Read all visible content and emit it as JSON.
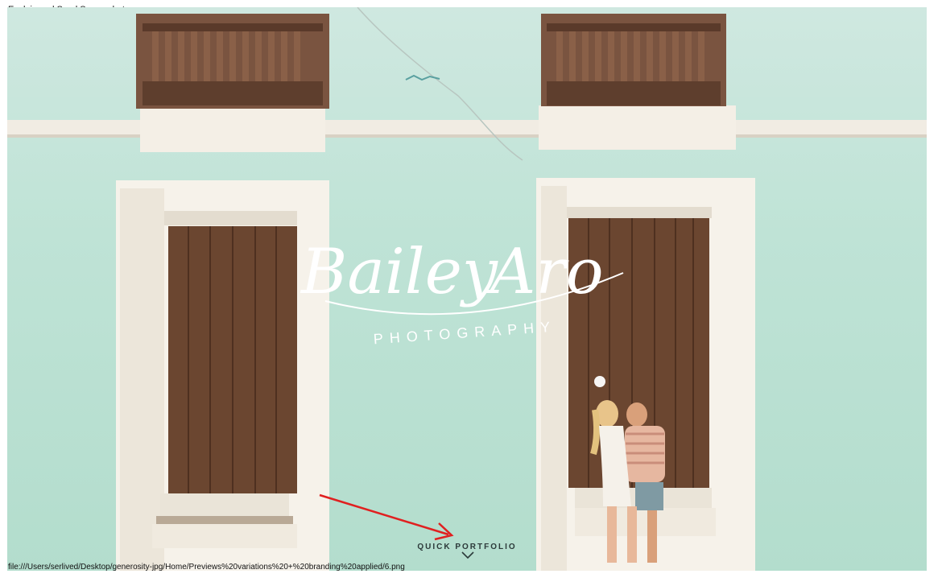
{
  "window": {
    "title": "Explain and Send Screenshots"
  },
  "brand": {
    "name_part1": "Bailey",
    "name_part2": "Aro",
    "tagline": "PHOTOGRAPHY"
  },
  "cta": {
    "label": "QUICK PORTFOLIO"
  },
  "status_bar": {
    "url": "file:///Users/serlived/Desktop/generosity-jpg/Home/Previews%20variations%20+%20branding%20applied/6.png"
  },
  "icons": {
    "scroll": "chevron-down-icon",
    "annotation": "red-arrow-icon",
    "slider": "slider-dot-icon"
  },
  "colors": {
    "wall": "#bfe3d6",
    "wood": "#6b4a36",
    "trim": "#f4efe6",
    "annotation": "#e02020"
  }
}
